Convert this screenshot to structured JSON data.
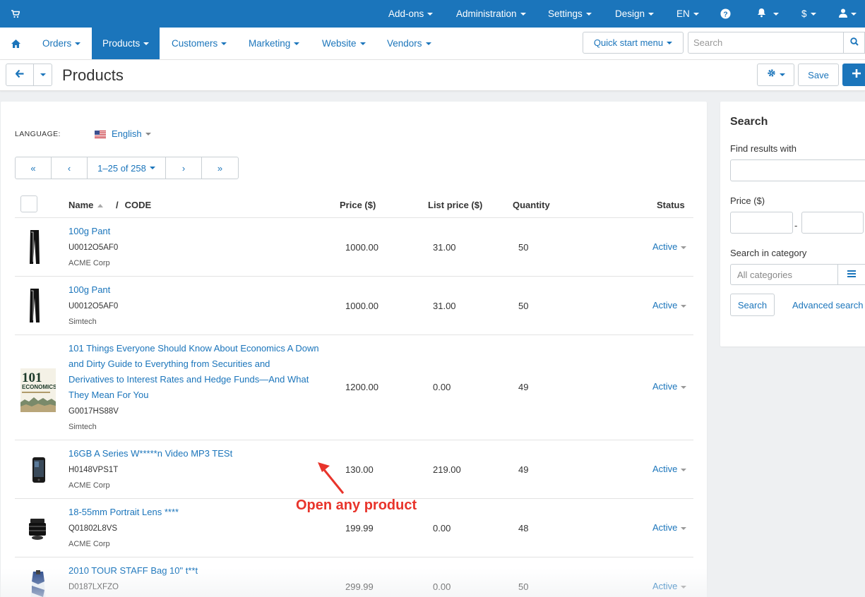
{
  "topbar": {
    "cart_icon": "cart-icon",
    "items": [
      {
        "label": "Add-ons"
      },
      {
        "label": "Administration"
      },
      {
        "label": "Settings"
      },
      {
        "label": "Design"
      },
      {
        "label": "EN"
      },
      {
        "label": "$"
      }
    ],
    "help_icon": "question-circle-icon",
    "bell_icon": "bell-icon",
    "user_icon": "user-icon",
    "color": "#1b75bb"
  },
  "mainnav": {
    "home_icon": "home-icon",
    "items": [
      {
        "label": "Orders"
      },
      {
        "label": "Products",
        "active": true
      },
      {
        "label": "Customers"
      },
      {
        "label": "Marketing"
      },
      {
        "label": "Website"
      },
      {
        "label": "Vendors"
      }
    ],
    "quick_start": "Quick start menu",
    "search_placeholder": "Search"
  },
  "page": {
    "title": "Products",
    "save_label": "Save"
  },
  "language": {
    "label": "LANGUAGE:",
    "value": "English"
  },
  "pager": {
    "first": "«",
    "prev": "‹",
    "range": "1–25 of 258",
    "next": "›",
    "last": "»"
  },
  "table": {
    "headers": {
      "name": "Name",
      "separator": "/",
      "code": "CODE",
      "price": "Price ($)",
      "list_price": "List price ($)",
      "quantity": "Quantity",
      "status": "Status"
    },
    "rows": [
      {
        "name": "100g Pant",
        "code": "U0012O5AF0",
        "vendor": "ACME Corp",
        "price": "1000.00",
        "list_price": "31.00",
        "quantity": "50",
        "status": "Active"
      },
      {
        "name": "100g Pant",
        "code": "U0012O5AF0",
        "vendor": "Simtech",
        "price": "1000.00",
        "list_price": "31.00",
        "quantity": "50",
        "status": "Active"
      },
      {
        "name_lines": [
          "101 Things Everyone Should Know About Economics A Down",
          "and Dirty Guide to Everything from Securities and",
          "Derivatives to Interest Rates and Hedge Funds—And What",
          "They Mean For You"
        ],
        "code": "G0017HS88V",
        "vendor": "Simtech",
        "price": "1200.00",
        "list_price": "0.00",
        "quantity": "49",
        "status": "Active",
        "thumb_text_1": "101",
        "thumb_text_2": "ECONOMICS"
      },
      {
        "name": "16GB A Series W*****n Video MP3 TESt",
        "code": "H0148VPS1T",
        "vendor": "ACME Corp",
        "price": "130.00",
        "list_price": "219.00",
        "quantity": "49",
        "status": "Active"
      },
      {
        "name": "18-55mm Portrait Lens ****",
        "code": "Q01802L8VS",
        "vendor": "ACME Corp",
        "price": "199.99",
        "list_price": "0.00",
        "quantity": "48",
        "status": "Active"
      },
      {
        "name": "2010 TOUR STAFF Bag 10\" t**t",
        "code": "D0187LXFZO",
        "vendor": "",
        "price": "299.99",
        "list_price": "0.00",
        "quantity": "50",
        "status": "Active"
      }
    ]
  },
  "annotation": {
    "text": "Open any product",
    "color": "#e8342b"
  },
  "side": {
    "title": "Search",
    "find_label": "Find results with",
    "price_label": "Price ($)",
    "price_sep": "-",
    "category_label": "Search in category",
    "category_value": "All categories",
    "search_button": "Search",
    "advanced": "Advanced search"
  }
}
